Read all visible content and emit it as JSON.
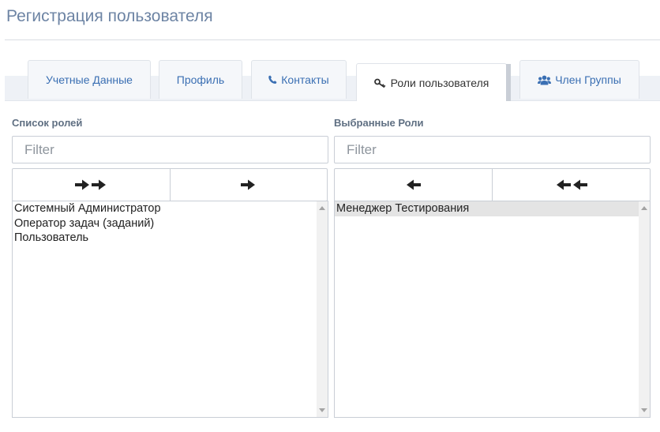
{
  "page": {
    "title": "Регистрация пользователя"
  },
  "tabs": [
    {
      "label": "Учетные Данные",
      "icon": ""
    },
    {
      "label": "Профиль",
      "icon": ""
    },
    {
      "label": "Контакты",
      "icon": "phone-icon"
    },
    {
      "label": "Роли пользователя",
      "icon": "key-icon",
      "active": true
    },
    {
      "label": "Член Группы",
      "icon": "users-icon"
    }
  ],
  "available": {
    "label": "Список ролей",
    "filter_placeholder": "Filter",
    "buttons": [
      "move-all-right",
      "move-selected-right"
    ],
    "items": [
      "Системный Администратор",
      "Оператор задач (заданий)",
      "Пользователь"
    ]
  },
  "selected": {
    "label": "Выбранные Роли",
    "filter_placeholder": "Filter",
    "buttons": [
      "move-selected-left",
      "move-all-left"
    ],
    "items": [
      "Менеджер Тестирования"
    ],
    "highlighted_index": 0
  },
  "colors": {
    "title": "#6d84a4",
    "tab_text": "#3a6fb3",
    "label": "#5f6f82"
  }
}
